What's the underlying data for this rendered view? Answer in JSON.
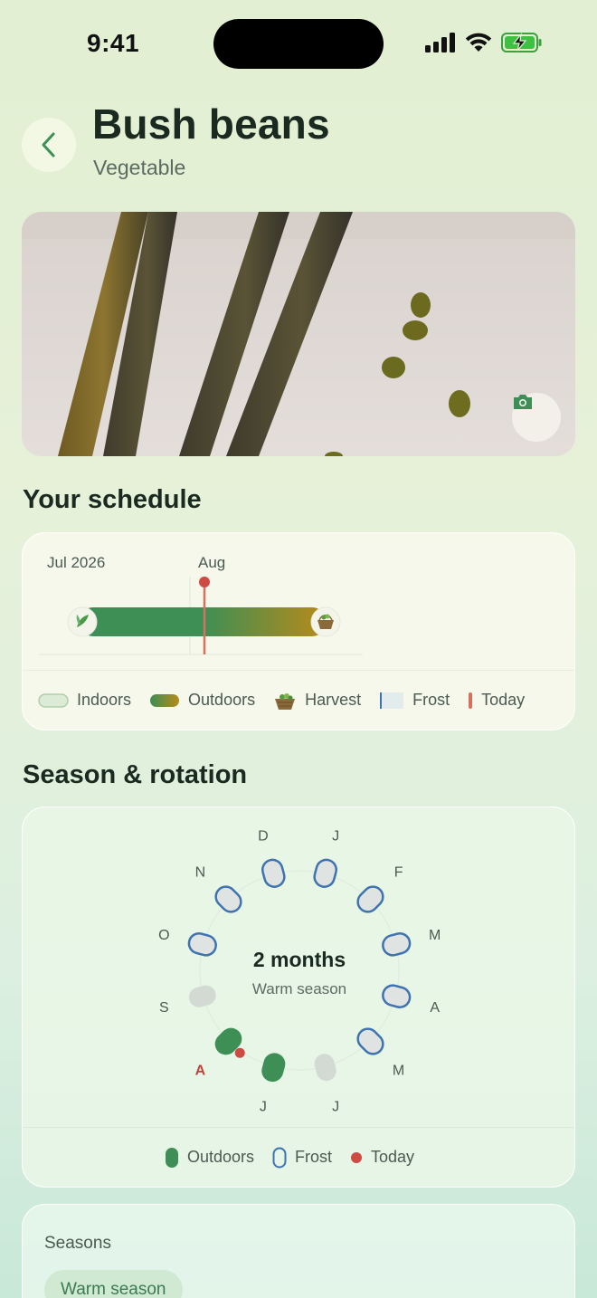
{
  "status_bar": {
    "time": "9:41"
  },
  "header": {
    "title": "Bush beans",
    "subtitle": "Vegetable"
  },
  "schedule": {
    "section_title": "Your schedule",
    "months": [
      "Jul 2026",
      "Aug"
    ],
    "legend": {
      "indoors": "Indoors",
      "outdoors": "Outdoors",
      "harvest": "Harvest",
      "frost": "Frost",
      "today": "Today"
    },
    "colors": {
      "outdoors_start": "#3d8f55",
      "outdoors_end": "#b88a1a",
      "today": "#d04a44",
      "frost": "#3f73b0"
    }
  },
  "season_rotation": {
    "section_title": "Season & rotation",
    "center_value": "2 months",
    "center_label": "Warm season",
    "months": [
      {
        "label": "J",
        "state": "frost"
      },
      {
        "label": "F",
        "state": "frost"
      },
      {
        "label": "M",
        "state": "frost"
      },
      {
        "label": "A",
        "state": "frost"
      },
      {
        "label": "M",
        "state": "frost"
      },
      {
        "label": "J",
        "state": "off"
      },
      {
        "label": "J",
        "state": "outdoors"
      },
      {
        "label": "A",
        "state": "outdoors",
        "today": true
      },
      {
        "label": "S",
        "state": "off"
      },
      {
        "label": "O",
        "state": "frost"
      },
      {
        "label": "N",
        "state": "frost"
      },
      {
        "label": "D",
        "state": "frost"
      }
    ],
    "legend": {
      "outdoors": "Outdoors",
      "frost": "Frost",
      "today": "Today"
    }
  },
  "seasons": {
    "label": "Seasons",
    "chip": "Warm season"
  }
}
